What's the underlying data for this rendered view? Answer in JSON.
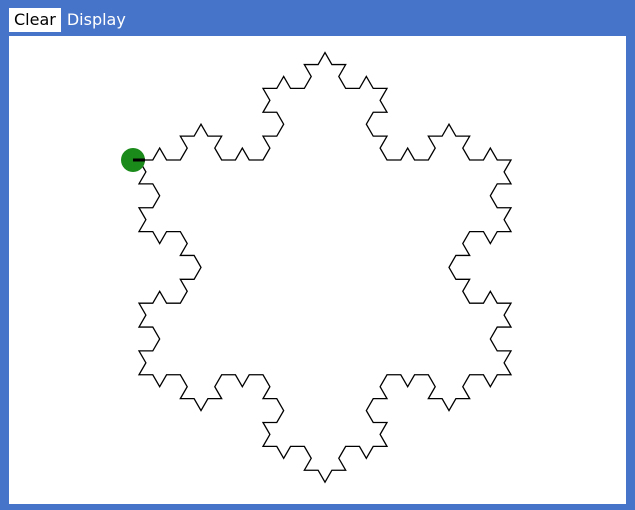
{
  "toolbar": {
    "clear_label": "Clear",
    "display_label": "Display"
  },
  "colors": {
    "window_bg": "#4674c8",
    "canvas_bg": "#ffffff",
    "curve": "#000000",
    "turtle": "#1a8a1a"
  },
  "drawing": {
    "shape": "koch-snowflake"
  }
}
